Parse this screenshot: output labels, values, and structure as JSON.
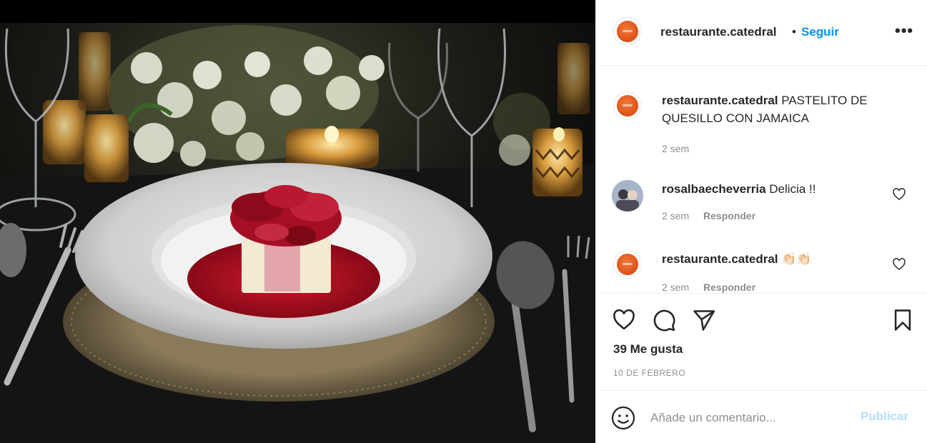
{
  "post": {
    "username": "restaurante.catedral",
    "separator": "•",
    "follow_label": "Seguir",
    "more_label": "•••"
  },
  "comments": [
    {
      "username": "restaurante.catedral",
      "text": "PASTELITO DE QUESILLO CON JAMAICA",
      "time": "2 sem"
    },
    {
      "username": "rosalbaecheverria",
      "text": "Delicia !!",
      "time": "2 sem",
      "reply": "Responder"
    },
    {
      "username": "restaurante.catedral",
      "text": "👏🏻👏🏻",
      "time": "2 sem",
      "reply": "Responder"
    }
  ],
  "actions": {
    "likes": "39 Me gusta",
    "date": "10 DE FEBRERO"
  },
  "compose": {
    "placeholder": "Añade un comentario...",
    "post_label": "Publicar"
  },
  "colors": {
    "accent": "#0095f6",
    "post_disabled": "#b2dffc",
    "secondary_text": "#8e8e8e"
  },
  "icons": [
    "heart-icon",
    "comment-icon",
    "share-icon",
    "bookmark-icon",
    "smile-icon",
    "more-icon"
  ]
}
